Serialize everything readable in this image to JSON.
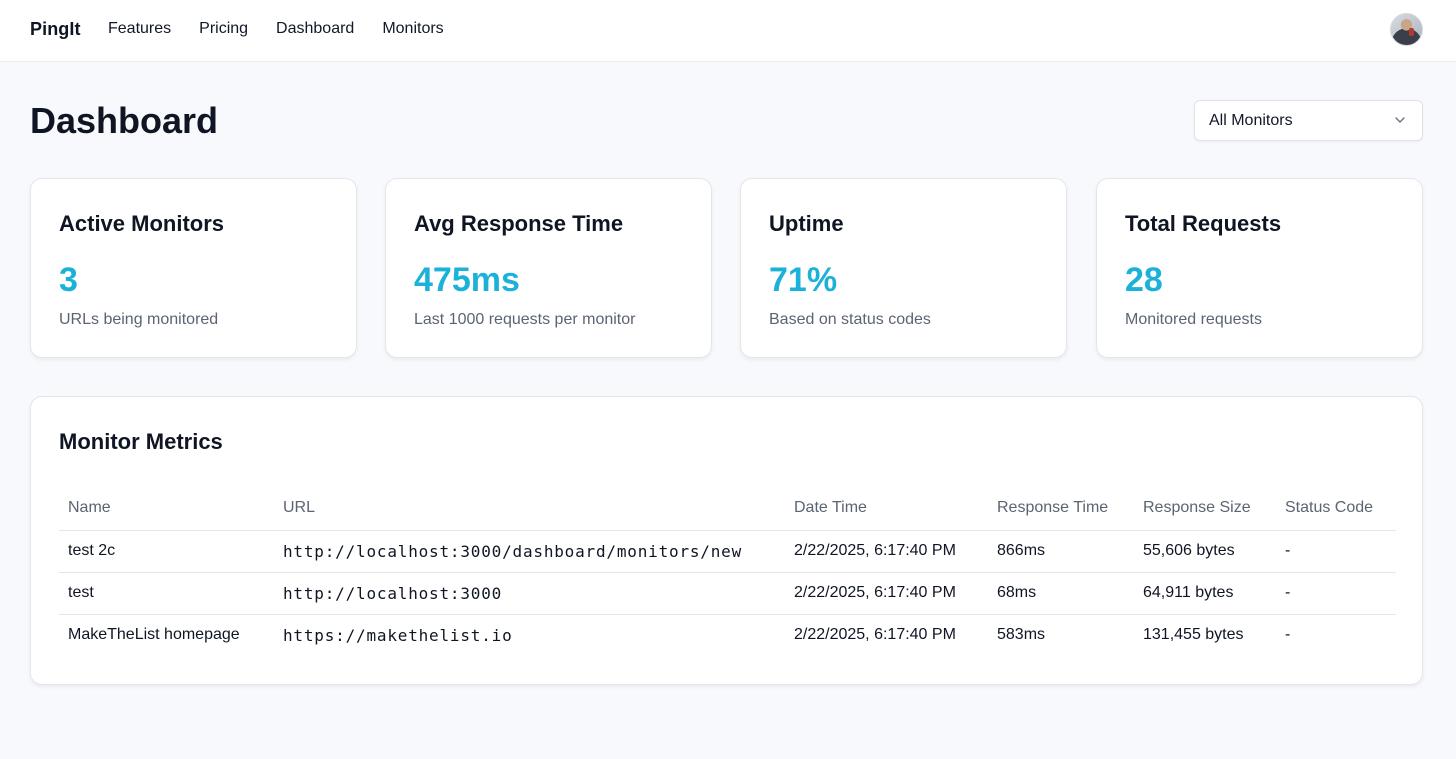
{
  "nav": {
    "brand": "PingIt",
    "links": [
      "Features",
      "Pricing",
      "Dashboard",
      "Monitors"
    ]
  },
  "header": {
    "title": "Dashboard",
    "filter_value": "All Monitors"
  },
  "stats": [
    {
      "title": "Active Monitors",
      "value": "3",
      "desc": "URLs being monitored"
    },
    {
      "title": "Avg Response Time",
      "value": "475ms",
      "desc": "Last 1000 requests per monitor"
    },
    {
      "title": "Uptime",
      "value": "71%",
      "desc": "Based on status codes"
    },
    {
      "title": "Total Requests",
      "value": "28",
      "desc": "Monitored requests"
    }
  ],
  "metrics": {
    "title": "Monitor Metrics",
    "columns": [
      "Name",
      "URL",
      "Date Time",
      "Response Time",
      "Response Size",
      "Status Code"
    ],
    "rows": [
      [
        "test 2c",
        "http://localhost:3000/dashboard/monitors/new",
        "2/22/2025, 6:17:40 PM",
        "866ms",
        "55,606 bytes",
        "-"
      ],
      [
        "test",
        "http://localhost:3000",
        "2/22/2025, 6:17:40 PM",
        "68ms",
        "64,911 bytes",
        "-"
      ],
      [
        "MakeTheList homepage",
        "https://makethelist.io",
        "2/22/2025, 6:17:40 PM",
        "583ms",
        "131,455 bytes",
        "-"
      ]
    ]
  },
  "colors": {
    "accent": "#1bb1d8",
    "muted_text": "#5b6472",
    "background": "#f8f9fc"
  },
  "icons": {
    "avatar": "user-avatar",
    "select": "chevron-down-icon"
  }
}
